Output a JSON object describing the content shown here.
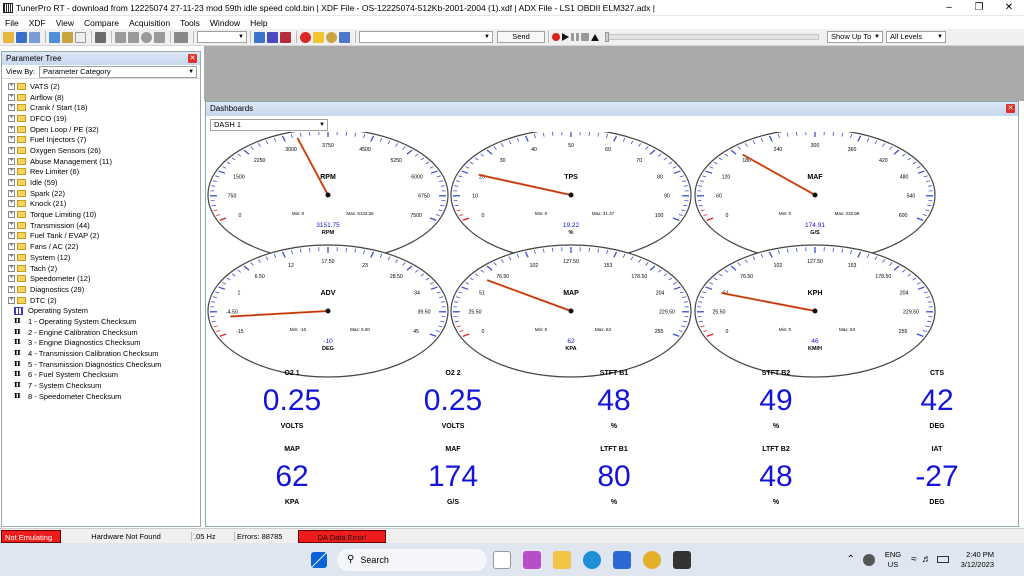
{
  "window": {
    "title": "TunerPro RT - download from 12225074 27-11-23 mod 59th idle speed cold.bin | XDF File - OS-12225074-512Kb-2001-2004 (1).xdf | ADX File - LS1 OBDII ELM327.adx |"
  },
  "menu": [
    "File",
    "XDF",
    "View",
    "Compare",
    "Acquisition",
    "Tools",
    "Window",
    "Help"
  ],
  "toolbar": {
    "send_label": "Send",
    "show_up_to": "Show Up To",
    "levels": "All Levels"
  },
  "tree": {
    "title": "Parameter Tree",
    "viewby_label": "View By:",
    "viewby_value": "Parameter Category",
    "folders": [
      "VATS (2)",
      "Airflow (8)",
      "Crank / Start (18)",
      "DFCO (19)",
      "Open Loop / PE (32)",
      "Fuel Injectors (7)",
      "Oxygen Sensors (26)",
      "Abuse Management (11)",
      "Rev Limiter (6)",
      "Idle (59)",
      "Spark (22)",
      "Knock (21)",
      "Torque Limiting (10)",
      "Transmission (44)",
      "Fuel Tank / EVAP (2)",
      "Fans / AC (22)",
      "System (12)",
      "Tach (2)",
      "Speedometer (12)",
      "Diagnostics (29)",
      "DTC (2)"
    ],
    "table_item": "Operating System",
    "checksums": [
      "1 - Operating System Checksum",
      "2 - Engine Calibration Checksum",
      "3 - Engine Diagnostics Checksum",
      "4 - Transmission Calibration Checksum",
      "5 - Transmission Diagnostics Checksum",
      "6 - Fuel System Checksum",
      "7 - System Checksum",
      "8 - Speedometer Checksum"
    ]
  },
  "dash": {
    "title": "Dashboards",
    "selected": "DASH 1"
  },
  "gauges": [
    {
      "name": "RPM",
      "unit": "RPM",
      "value": "3151.75",
      "min": "Min: 0",
      "max": "Max: 5132.25",
      "ticks": [
        "0",
        "750",
        "1500",
        "2250",
        "3000",
        "3750",
        "4500",
        "5250",
        "6000",
        "6750",
        "7500"
      ],
      "needle": 0.42
    },
    {
      "name": "TPS",
      "unit": "%",
      "value": "19.22",
      "min": "Min: 0",
      "max": "Max: 31.37",
      "ticks": [
        "0",
        "10",
        "20",
        "30",
        "40",
        "50",
        "60",
        "70",
        "80",
        "90",
        "100"
      ],
      "needle": 0.19
    },
    {
      "name": "MAF",
      "unit": "G/S",
      "value": "174.91",
      "min": "Min: 0",
      "max": "Max: 232.98",
      "ticks": [
        "0",
        "60",
        "120",
        "180",
        "240",
        "300",
        "360",
        "420",
        "480",
        "540",
        "600"
      ],
      "needle": 0.29
    },
    {
      "name": "ADV",
      "unit": "DEG",
      "value": "-10",
      "min": "Min: -10",
      "max": "Max: 5.00",
      "ticks": [
        "-15",
        "-4.50",
        "1",
        "6.50",
        "12",
        "17.50",
        "23",
        "28.50",
        "34",
        "39.50",
        "45"
      ],
      "needle": 0.08
    },
    {
      "name": "MAP",
      "unit": "KPA",
      "value": "62",
      "min": "Min: 0",
      "max": "Max: 63",
      "ticks": [
        "0",
        "25.50",
        "51",
        "76.50",
        "102",
        "127.50",
        "153",
        "178.50",
        "204",
        "229.50",
        "255"
      ],
      "needle": 0.24
    },
    {
      "name": "KPH",
      "unit": "KM/H",
      "value": "46",
      "min": "Min: 0",
      "max": "Max: 63",
      "ticks": [
        "0",
        "25.50",
        "51",
        "76.50",
        "102",
        "127.50",
        "153",
        "178.50",
        "204",
        "229.50",
        "255"
      ],
      "needle": 0.18
    }
  ],
  "digits": [
    {
      "label": "O2 1",
      "value": "0.25",
      "unit": "VOLTS"
    },
    {
      "label": "O2 2",
      "value": "0.25",
      "unit": "VOLTS"
    },
    {
      "label": "STFT B1",
      "value": "48",
      "unit": "%"
    },
    {
      "label": "STFT B2",
      "value": "49",
      "unit": "%"
    },
    {
      "label": "CTS",
      "value": "42",
      "unit": "DEG"
    },
    {
      "label": "MAP",
      "value": "62",
      "unit": "KPA"
    },
    {
      "label": "MAF",
      "value": "174",
      "unit": "G/S"
    },
    {
      "label": "LTFT B1",
      "value": "80",
      "unit": "%"
    },
    {
      "label": "LTFT B2",
      "value": "48",
      "unit": "%"
    },
    {
      "label": "IAT",
      "value": "-27",
      "unit": "DEG"
    }
  ],
  "status": {
    "emu": "Not Emulating",
    "hw": "Hardware Not Found",
    "hz": ".05 Hz",
    "errors": "Errors: 88785",
    "da": "DA Data Error!"
  },
  "taskbar": {
    "search": "Search",
    "lang1": "ENG",
    "lang2": "US",
    "time": "2:40 PM",
    "date": "3/12/2023"
  },
  "colors": {
    "accent_red": "#d9352b",
    "digit_blue": "#1414d8",
    "needle": "#e8541c"
  }
}
